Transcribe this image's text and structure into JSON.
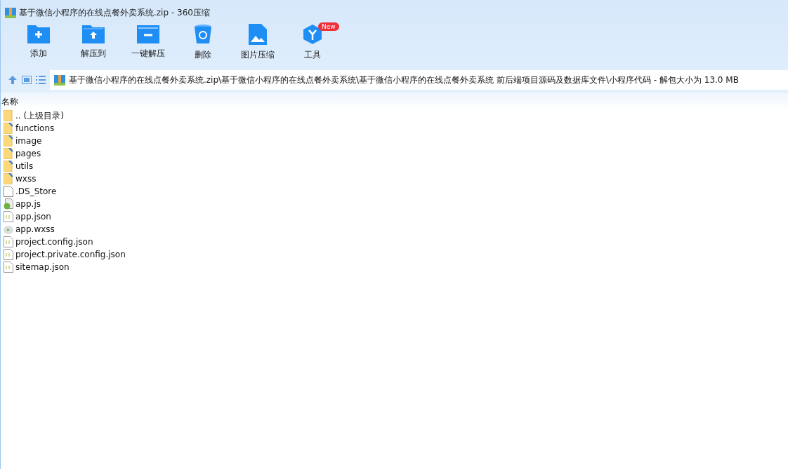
{
  "window": {
    "title": "基于微信小程序的在线点餐外卖系统.zip - 360压缩"
  },
  "toolbar": [
    {
      "label": "添加",
      "kind": "add"
    },
    {
      "label": "解压到",
      "kind": "extract"
    },
    {
      "label": "一键解压",
      "kind": "quick"
    },
    {
      "label": "删除",
      "kind": "delete"
    },
    {
      "label": "图片压缩",
      "kind": "image"
    },
    {
      "label": "工具",
      "kind": "tools",
      "badge": "New"
    }
  ],
  "address": {
    "path": "基于微信小程序的在线点餐外卖系统.zip\\基于微信小程序的在线点餐外卖系统\\基于微信小程序的在线点餐外卖系统 前后端项目源码及数据库文件\\小程序代码 - 解包大小为 13.0 MB"
  },
  "table": {
    "columns": [
      "名称"
    ],
    "rows": [
      {
        "name": ".. (上级目录)",
        "kind": "parent"
      },
      {
        "name": "functions",
        "kind": "folder"
      },
      {
        "name": "image",
        "kind": "folder"
      },
      {
        "name": "pages",
        "kind": "folder"
      },
      {
        "name": "utils",
        "kind": "folder"
      },
      {
        "name": "wxss",
        "kind": "folder"
      },
      {
        "name": ".DS_Store",
        "kind": "file"
      },
      {
        "name": "app.js",
        "kind": "js"
      },
      {
        "name": "app.json",
        "kind": "json"
      },
      {
        "name": "app.wxss",
        "kind": "css"
      },
      {
        "name": "project.config.json",
        "kind": "json"
      },
      {
        "name": "project.private.config.json",
        "kind": "json"
      },
      {
        "name": "sitemap.json",
        "kind": "json"
      }
    ]
  }
}
